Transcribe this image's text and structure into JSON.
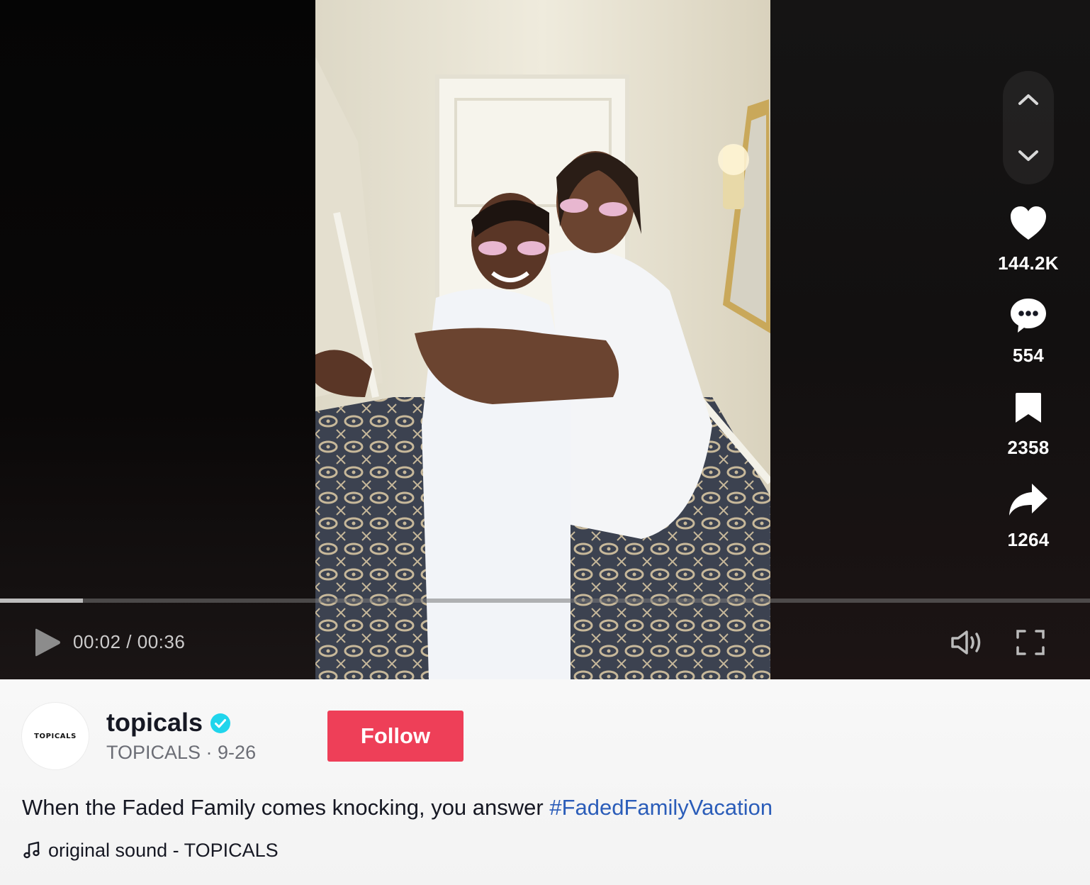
{
  "player": {
    "time_current": "00:02",
    "time_total": "00:36",
    "time_display": "00:02 / 00:36",
    "progress_fraction": 0.076,
    "is_playing": false
  },
  "actions": {
    "likes": "144.2K",
    "comments": "554",
    "saves": "2358",
    "shares": "1264"
  },
  "author": {
    "username": "topicals",
    "verified": true,
    "display_name": "TOPICALS",
    "date": "9-26",
    "subline": "TOPICALS · 9-26",
    "avatar_text": "TOPICALS"
  },
  "follow_label": "Follow",
  "caption": {
    "text": "When the Faded Family comes knocking, you answer ",
    "hashtag": "#FadedFamilyVacation"
  },
  "sound": {
    "label": "original sound - TOPICALS"
  },
  "colors": {
    "follow_bg": "#ee3f58",
    "hashtag": "#2b5db9",
    "verified": "#20d5ec"
  },
  "icons": {
    "nav_up": "chevron-up-icon",
    "nav_down": "chevron-down-icon",
    "like": "heart-icon",
    "comment": "comment-icon",
    "save": "bookmark-icon",
    "share": "share-icon",
    "play": "play-icon",
    "volume": "volume-icon",
    "fullscreen": "fullscreen-icon",
    "music": "music-note-icon"
  }
}
